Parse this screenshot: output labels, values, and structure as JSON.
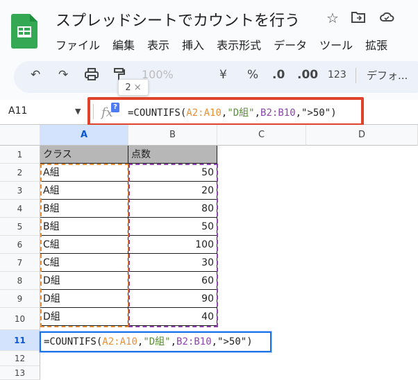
{
  "header": {
    "title": "スプレッドシートでカウントを行う",
    "menu": [
      "ファイル",
      "編集",
      "表示",
      "挿入",
      "表示形式",
      "データ",
      "ツール",
      "拡張"
    ]
  },
  "toolbar": {
    "zoom": "100%",
    "currency": "¥",
    "percent": "%",
    "decrease_decimal": ".0",
    "increase_decimal": ".00",
    "number_format": "123",
    "font": "デフォ...",
    "tooltip_count": "2"
  },
  "formula_bar": {
    "name_box": "A11",
    "help_badge": "?",
    "fx_label": "fx",
    "formula_parts": [
      "=COUNTIFS(",
      "A2:A10",
      ",",
      "\"D組\"",
      ",",
      "B2:B10",
      ",\">50\")"
    ]
  },
  "grid": {
    "columns": [
      "A",
      "B",
      "C",
      "D"
    ],
    "row_numbers": [
      "1",
      "2",
      "3",
      "4",
      "5",
      "6",
      "7",
      "8",
      "9",
      "10",
      "11",
      "12",
      "13"
    ],
    "headers": [
      "クラス",
      "点数"
    ],
    "rows": [
      [
        "A組",
        "50"
      ],
      [
        "A組",
        "20"
      ],
      [
        "B組",
        "80"
      ],
      [
        "B組",
        "50"
      ],
      [
        "C組",
        "100"
      ],
      [
        "C組",
        "30"
      ],
      [
        "D組",
        "60"
      ],
      [
        "D組",
        "90"
      ],
      [
        "D組",
        "40"
      ]
    ],
    "active_cell": "A11"
  },
  "colors": {
    "range1": "#e69138",
    "criteria": "#5b8f3a",
    "range2": "#8e44ad",
    "highlight_box": "#e0432b",
    "edit_border": "#1a73e8"
  }
}
